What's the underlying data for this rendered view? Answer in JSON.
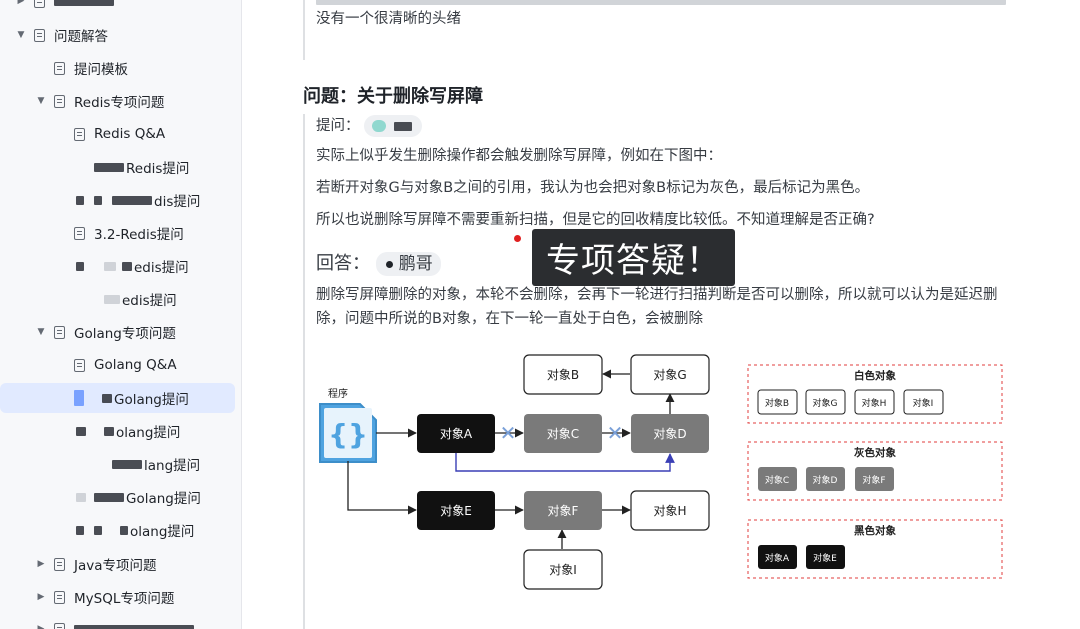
{
  "sidebar": {
    "items": [
      {
        "label": "问题解答"
      },
      {
        "label": "提问模板"
      },
      {
        "label": "Redis专项问题"
      },
      {
        "label": "Redis Q&A"
      },
      {
        "label": "Redis提问"
      },
      {
        "label": "dis提问"
      },
      {
        "label": "3.2-Redis提问"
      },
      {
        "label": "edis提问"
      },
      {
        "label": "edis提问"
      },
      {
        "label": "Golang专项问题"
      },
      {
        "label": "Golang Q&A"
      },
      {
        "label": "Golang提问"
      },
      {
        "label": "olang提问"
      },
      {
        "label": "lang提问"
      },
      {
        "label": "Golang提问"
      },
      {
        "label": "olang提问"
      },
      {
        "label": "Java专项问题"
      },
      {
        "label": "MySQL专项问题"
      }
    ]
  },
  "content": {
    "prev_text": "没有一个很清晰的头绪",
    "question_heading": "问题：关于删除写屏障",
    "asker_label": "提问：",
    "question_lines": [
      "实际上似乎发生删除操作都会触发删除写屏障，例如在下图中：",
      "若断开对象G与对象B之间的引用，我认为也会把对象B标记为灰色，最后标记为黑色。",
      "所以也说删除写屏障不需要重新扫描，但是它的回收精度比较低。不知道理解是否正确?"
    ],
    "answer_label": "回答：",
    "answerer": "鹏哥",
    "answer_lines": [
      "删除写屏障删除的对象，本轮不会删除，会再下一轮进行扫描判断是否可以删除，所以就可以认为是延迟删",
      "除，问题中所说的B对象，在下一轮一直处于白色，会被删除"
    ],
    "overlay_badge": "专项答疑！"
  },
  "diagram": {
    "program_label": "程序",
    "program_icon": "{}",
    "nodes": {
      "A": "对象A",
      "B": "对象B",
      "C": "对象C",
      "D": "对象D",
      "E": "对象E",
      "F": "对象F",
      "G": "对象G",
      "H": "对象H",
      "I": "对象I"
    },
    "legend": {
      "white_title": "白色对象",
      "white_items": [
        "对象B",
        "对象G",
        "对象H",
        "对象I"
      ],
      "gray_title": "灰色对象",
      "gray_items": [
        "对象C",
        "对象D",
        "对象F"
      ],
      "black_title": "黑色对象",
      "black_items": [
        "对象A",
        "对象E"
      ]
    },
    "colors": {
      "black": "#111111",
      "gray": "#7a7a7a",
      "white": "#ffffff",
      "program": "#4fa3e0",
      "blue_arrow": "#3a3fb5",
      "legend_border": "#e03c3c"
    }
  }
}
